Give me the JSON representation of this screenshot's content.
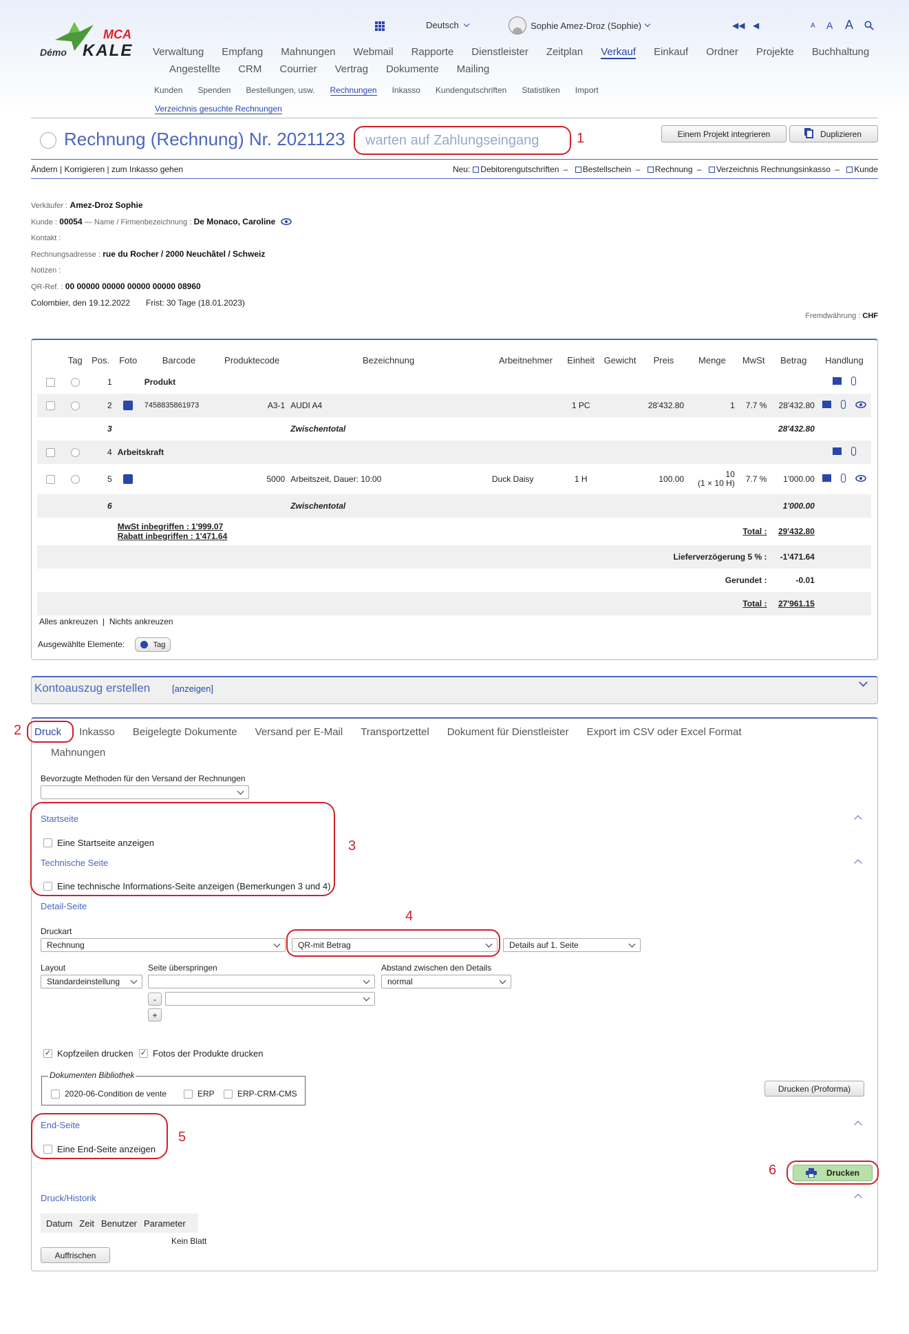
{
  "header": {
    "logo_demo": "Démo",
    "logo_mca": "MCA",
    "logo_kale": "KALE",
    "language": "Deutsch",
    "user": "Sophie Amez-Droz (Sophie)",
    "font_sizes": [
      "A",
      "A",
      "A"
    ],
    "nav_main_row1": [
      "Verwaltung",
      "Empfang",
      "Mahnungen",
      "Webmail",
      "Rapporte",
      "Dienstleister",
      "Zeitplan",
      "Verkauf",
      "Einkauf",
      "Ordner",
      "Projekte",
      "Buchhaltung"
    ],
    "nav_main_row2": [
      "Angestellte",
      "CRM",
      "Courrier",
      "Vertrag",
      "Dokumente",
      "Mailing"
    ],
    "nav_main_active": "Verkauf",
    "nav_sub": [
      "Kunden",
      "Spenden",
      "Bestellungen, usw.",
      "Rechnungen",
      "Inkasso",
      "Kundengutschriften",
      "Statistiken",
      "Import"
    ],
    "nav_sub_active": "Rechnungen",
    "nav_sub2": "Verzeichnis gesuchte Rechnungen"
  },
  "title": {
    "text": "Rechnung (Rechnung) Nr. 2021123",
    "status": "warten auf Zahlungseingang",
    "btn_project": "Einem Projekt integrieren",
    "btn_duplicate": "Duplizieren"
  },
  "actions": {
    "left": [
      "Ändern",
      "Korrigieren",
      "zum Inkasso gehen"
    ],
    "new_label": "Neu:",
    "new_links": [
      "Debitorengutschriften",
      "Bestellschein",
      "Rechnung",
      "Verzeichnis Rechnungsinkasso",
      "Kunde"
    ]
  },
  "info": {
    "seller_label": "Verkäufer :",
    "seller": "Amez-Droz Sophie",
    "customer_label": "Kunde :",
    "customer_no": "00054",
    "name_label": "— Name / Firmenbezeichnung :",
    "customer_name": "De Monaco, Caroline",
    "contact_label": "Kontakt :",
    "address_label": "Rechnungsadresse :",
    "address": "rue du Rocher / 2000 Neuchâtel / Schweiz",
    "notes_label": "Notizen :",
    "qr_label": "QR-Ref. :",
    "qr": "00 00000 00000 00000 00000 08960",
    "place_date": "Colombier, den 19.12.2022",
    "deadline": "Frist: 30 Tage (18.01.2023)",
    "currency_label": "Fremdwährung :",
    "currency": "CHF"
  },
  "table": {
    "headers": [
      "",
      "Tag",
      "Pos.",
      "Foto",
      "Barcode",
      "Produktecode",
      "Bezeichnung",
      "Arbeitnehmer",
      "Einheit",
      "Gewicht",
      "Preis",
      "Menge",
      "MwSt",
      "Betrag",
      "Handlung"
    ],
    "rows": [
      {
        "pos": "1",
        "bold_title": "Produkt"
      },
      {
        "pos": "2",
        "barcode": "7458835861973",
        "code": "A3-1",
        "desc": "AUDI A4",
        "unit": "1 PC",
        "price": "28'432.80",
        "qty": "1",
        "vat": "7.7 %",
        "amount": "28'432.80"
      },
      {
        "pos": "3",
        "subtotal_label": "Zwischentotal",
        "subtotal": "28'432.80"
      },
      {
        "pos": "4",
        "bold_title": "Arbeitskraft"
      },
      {
        "pos": "5",
        "code": "5000",
        "desc": "Arbeitszeit, Dauer: 10:00",
        "employee": "Duck Daisy",
        "unit": "1 H",
        "price": "100.00",
        "qty": "10",
        "qty2": "(1 × 10 H)",
        "vat": "7.7 %",
        "amount": "1'000.00"
      },
      {
        "pos": "6",
        "subtotal_label": "Zwischentotal",
        "subtotal": "1'000.00"
      }
    ],
    "mwst_incl": "MwSt inbegriffen : 1'999.07",
    "rabatt_incl": "Rabatt inbegriffen : 1'471.64",
    "total_label": "Total :",
    "total": "29'432.80",
    "delay_label": "Lieferverzögerung 5 % :",
    "delay": "-1'471.64",
    "rounded_label": "Gerundet :",
    "rounded": "-0.01",
    "total2_label": "Total :",
    "total2": "27'961.15",
    "select_all": "Alles ankreuzen",
    "select_none": "Nichts ankreuzen",
    "selected_label": "Ausgewählte Elemente:",
    "tag_btn": "Tag"
  },
  "statement": {
    "title": "Kontoauszug erstellen",
    "show": "[anzeigen]"
  },
  "print": {
    "tabs": [
      "Druck",
      "Inkasso",
      "Beigelegte Dokumente",
      "Versand per E-Mail",
      "Transportzettel",
      "Dokument für Dienstleister",
      "Export im CSV oder Excel Format",
      "Mahnungen"
    ],
    "methods_label": "Bevorzugte Methoden für den Versand der Rechnungen",
    "methods_value": "",
    "start_title": "Startseite",
    "start_chk": "Eine Startseite anzeigen",
    "tech_title": "Technische Seite",
    "tech_chk": "Eine technische Informations-Seite anzeigen (Bemerkungen 3 und 4)",
    "detail_title": "Detail-Seite",
    "druckart_label": "Druckart",
    "druckart": "Rechnung",
    "qr_type": "QR-mit Betrag",
    "details": "Details auf 1. Seite",
    "layout_label": "Layout",
    "layout": "Standardeinstellung",
    "skip_label": "Seite überspringen",
    "skip": "",
    "skip2": "",
    "spacing_label": "Abstand zwischen den Details",
    "spacing": "normal",
    "minus": "-",
    "plus": "+",
    "headers_chk": "Kopfzeilen drucken",
    "photos_chk": "Fotos der Produkte drucken",
    "library_legend": "Dokumenten Bibliothek",
    "library": [
      "2020-06-Condition de vente",
      "ERP",
      "ERP-CRM-CMS"
    ],
    "proforma_btn": "Drucken (Proforma)",
    "end_title": "End-Seite",
    "end_chk": "Eine End-Seite anzeigen",
    "print_btn": "Drucken",
    "history_title": "Druck/Historik",
    "history_headers": [
      "Datum",
      "Zeit",
      "Benutzer",
      "Parameter"
    ],
    "history_empty": "Kein Blatt",
    "refresh_btn": "Auffrischen"
  },
  "annotations": [
    "1",
    "2",
    "3",
    "4",
    "5",
    "6"
  ],
  "colors": {
    "accent": "#2a46a8",
    "annotation": "#d0202a",
    "print_btn": "#b8e0a8",
    "logo_red": "#e0202a",
    "logo_green": "#4a9a3a"
  }
}
